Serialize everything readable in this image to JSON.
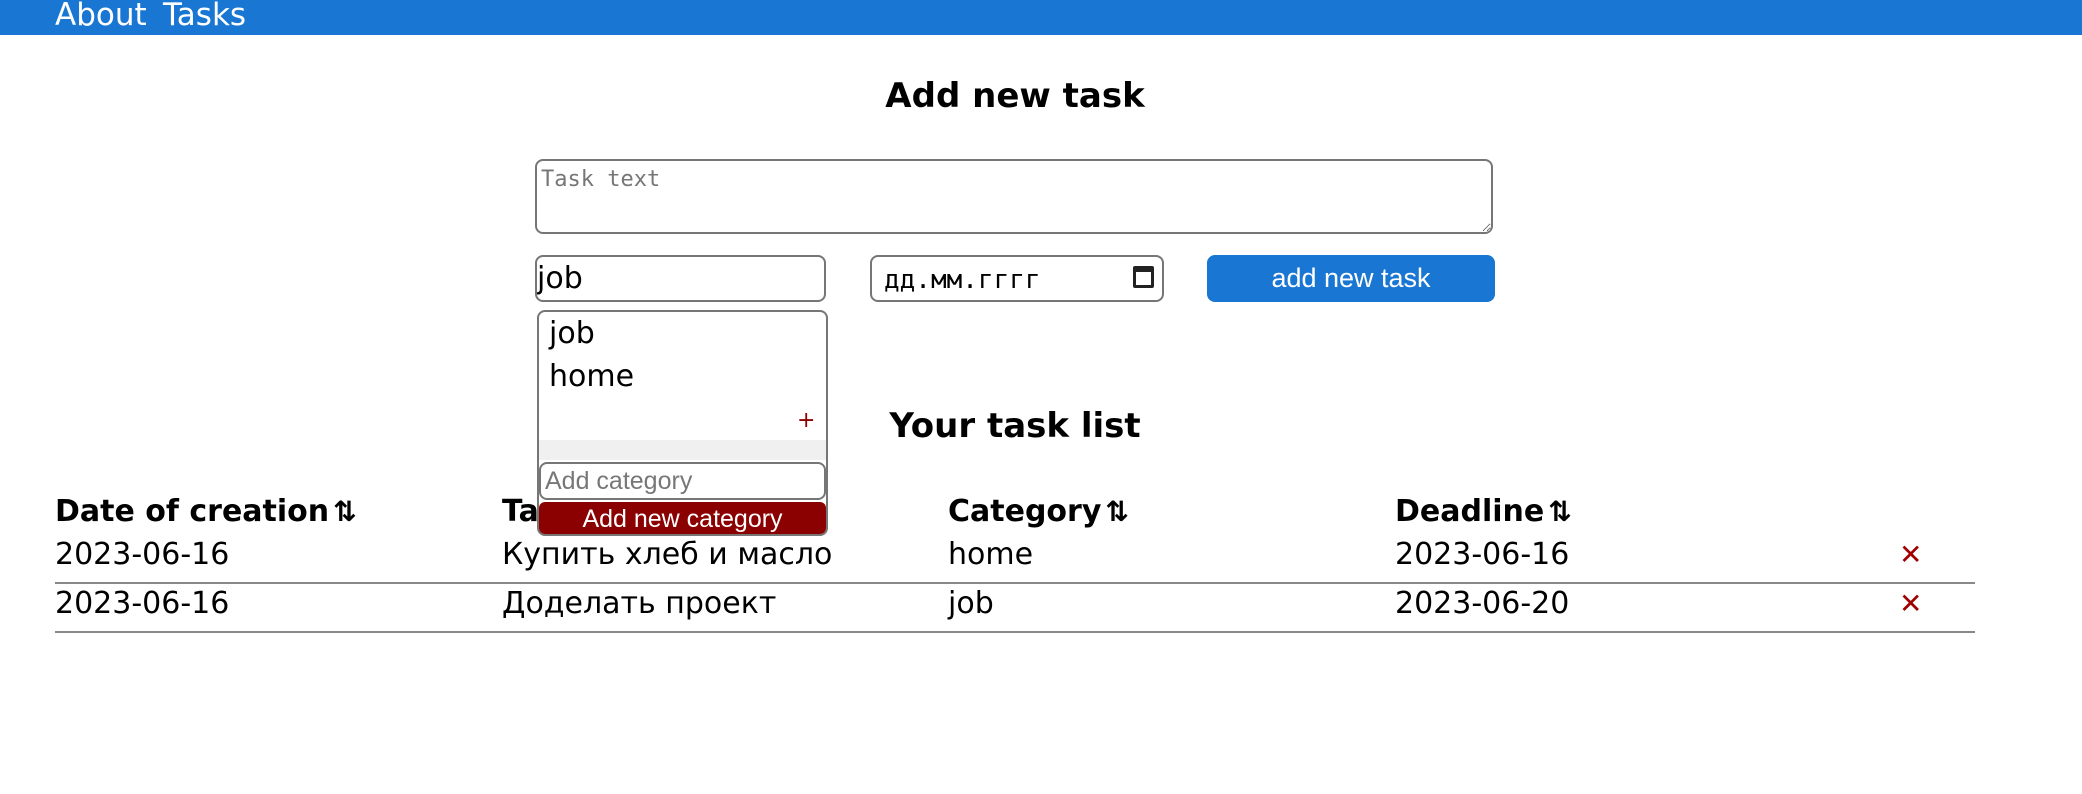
{
  "nav": {
    "about": "About",
    "tasks": "Tasks"
  },
  "form": {
    "heading": "Add new task",
    "task_placeholder": "Task text",
    "category_value": "job",
    "date_placeholder": "дд.мм.гггг",
    "add_button": "add new task"
  },
  "category_dropdown": {
    "options": [
      "job",
      "home"
    ],
    "plus": "+",
    "new_placeholder": "Add category",
    "add_button": "Add new category"
  },
  "list": {
    "heading": "Your task list",
    "sort_icon": "⇅",
    "columns": [
      "Date of creation",
      "Task",
      "Category",
      "Deadline"
    ],
    "rows": [
      {
        "created": "2023-06-16",
        "task": "Купить хлеб и масло",
        "category": "home",
        "deadline": "2023-06-16"
      },
      {
        "created": "2023-06-16",
        "task": "Доделать проект",
        "category": "job",
        "deadline": "2023-06-20"
      }
    ],
    "delete_icon": "✕"
  },
  "colors": {
    "nav": "#1976d2",
    "primary_button": "#1976d2",
    "danger": "#8b0000"
  }
}
